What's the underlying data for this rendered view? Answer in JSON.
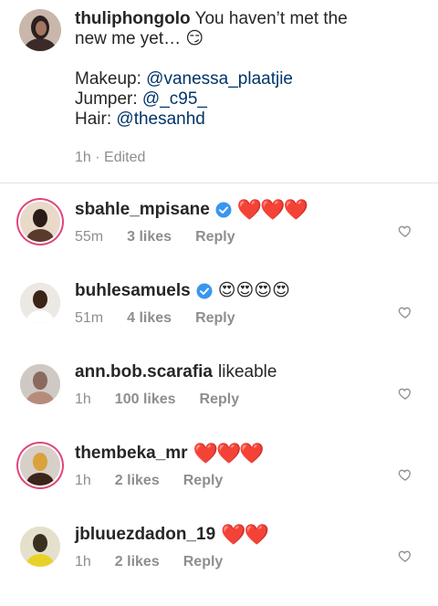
{
  "caption": {
    "username": "thuliphongolo",
    "text": "You haven’t met the",
    "text_line2": "new me yet… 😏",
    "makeup_label": "Makeup:",
    "makeup_handle": "@vanessa_plaatjie",
    "jumper_label": "Jumper:",
    "jumper_handle": "@_c95_",
    "hair_label": "Hair:",
    "hair_handle": "@thesanhd",
    "time": "1h · Edited"
  },
  "comments": [
    {
      "username": "sbahle_mpisane",
      "verified": true,
      "text": "❤️❤️❤️",
      "time": "55m",
      "likes": "3 likes",
      "reply": "Reply",
      "ring": true
    },
    {
      "username": "buhlesamuels",
      "verified": true,
      "text": "😍😍😍😍",
      "time": "51m",
      "likes": "4 likes",
      "reply": "Reply",
      "ring": false
    },
    {
      "username": "ann.bob.scarafia",
      "verified": false,
      "text": "likeable",
      "time": "1h",
      "likes": "100 likes",
      "reply": "Reply",
      "ring": false
    },
    {
      "username": "thembeka_mr",
      "verified": false,
      "text": "❤️❤️❤️",
      "time": "1h",
      "likes": "2 likes",
      "reply": "Reply",
      "ring": true
    },
    {
      "username": "jbluuezdadon_19",
      "verified": false,
      "text": "❤️❤️",
      "time": "1h",
      "likes": "2 likes",
      "reply": "Reply",
      "ring": false
    }
  ],
  "icons": {
    "verified": "verified-badge-icon",
    "like": "heart-outline-icon"
  },
  "colors": {
    "mention": "#003569",
    "meta": "#8e8e8e",
    "verified": "#3897f0",
    "story_ring": "#e0457b"
  }
}
